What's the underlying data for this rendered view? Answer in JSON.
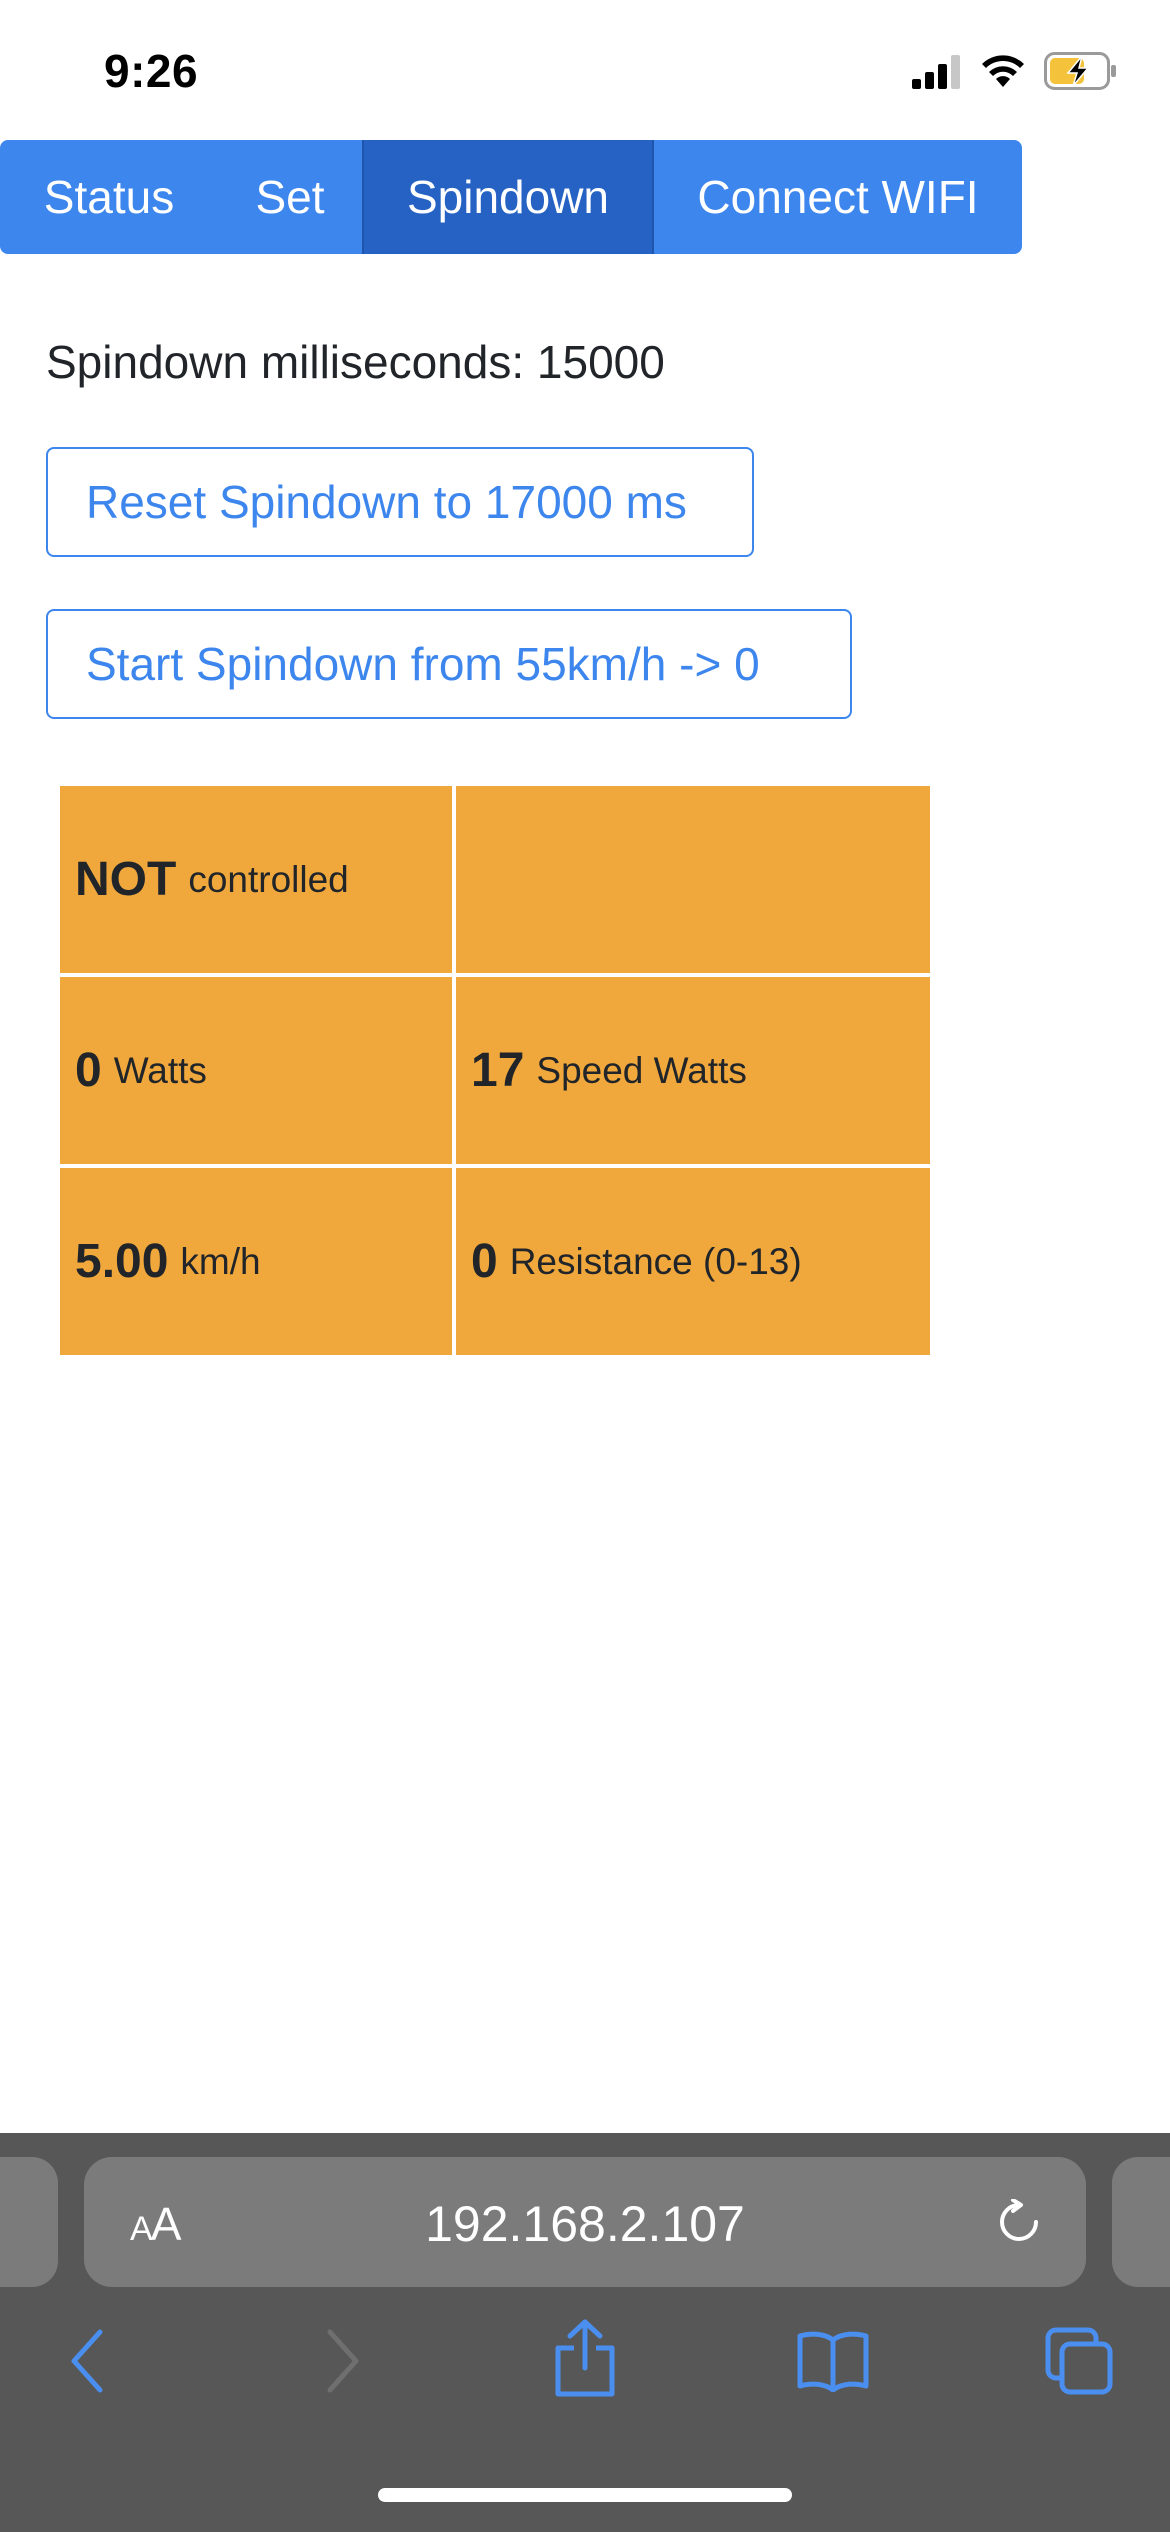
{
  "status_bar": {
    "time": "9:26"
  },
  "nav": {
    "tabs": [
      {
        "label": "Status",
        "active": false
      },
      {
        "label": "Set",
        "active": false
      },
      {
        "label": "Spindown",
        "active": true
      },
      {
        "label": "Connect WIFI",
        "active": false
      }
    ]
  },
  "spindown": {
    "line": "Spindown milliseconds: 15000",
    "reset_button": "Reset Spindown to 17000 ms",
    "start_button": "Start Spindown from 55km/h -> 0"
  },
  "grid": {
    "control_value": "NOT",
    "control_label": "controlled",
    "watts_value": "0",
    "watts_label": "Watts",
    "speed_watts_value": "17",
    "speed_watts_label": "Speed Watts",
    "speed_value": "5.00",
    "speed_label": "km/h",
    "resistance_value": "0",
    "resistance_label": "Resistance (0-13)"
  },
  "browser": {
    "text_size_label_big": "A",
    "text_size_label_small": "A",
    "url": "192.168.2.107"
  },
  "colors": {
    "accent": "#3d86ed",
    "active_tab": "#2562c4",
    "cell": "#f0a83c",
    "toolbar": "#575757"
  }
}
